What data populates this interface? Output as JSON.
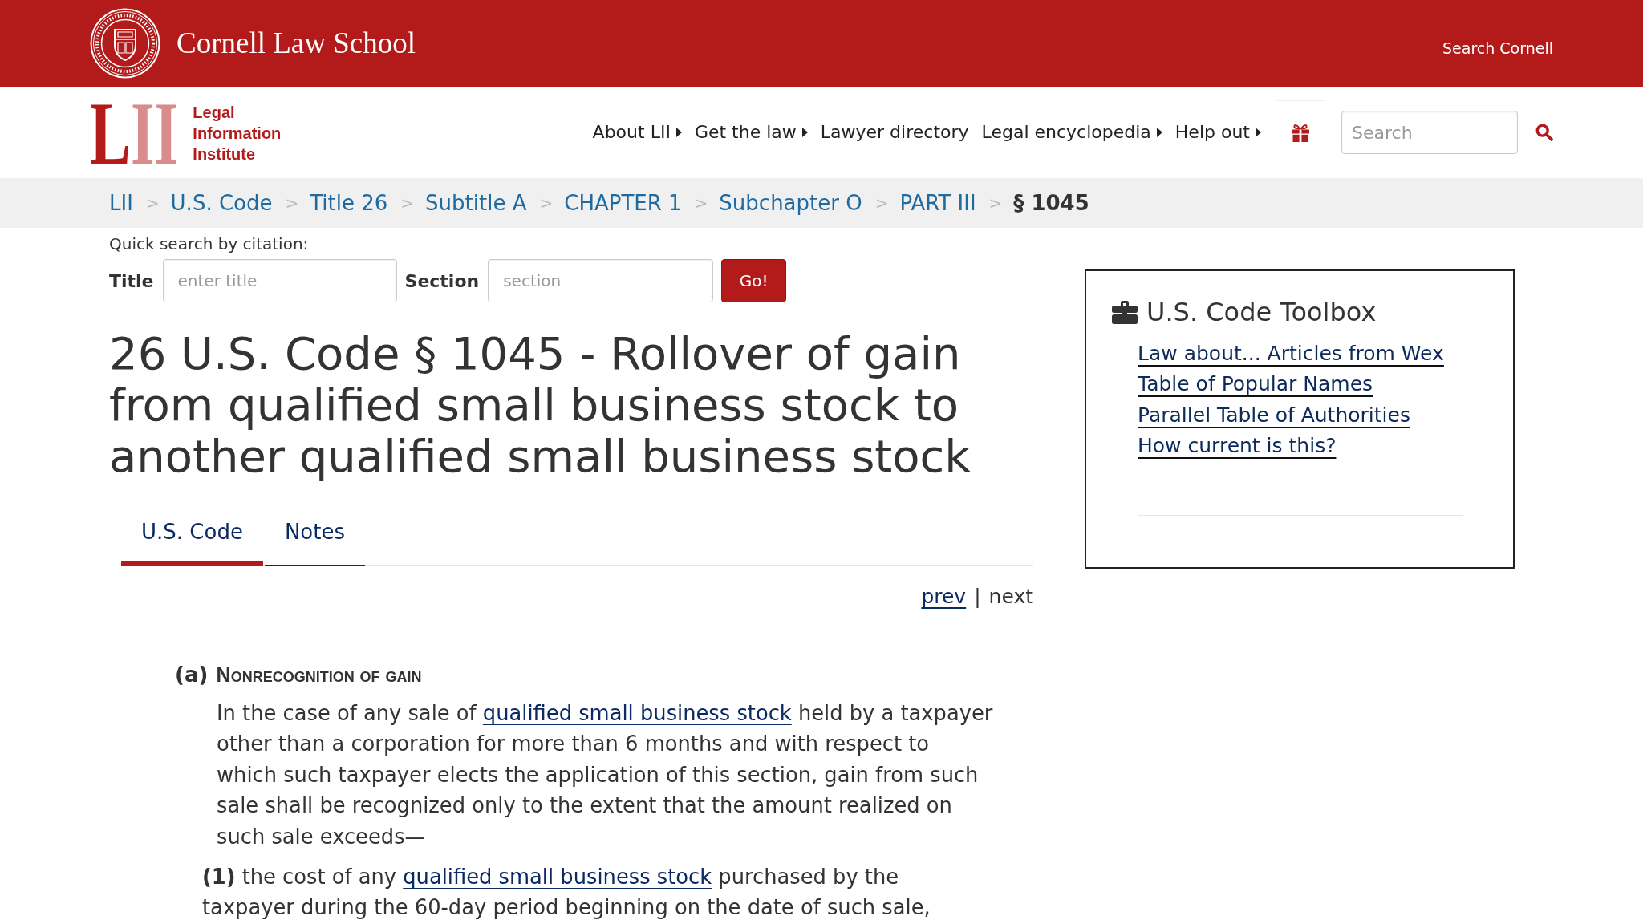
{
  "header": {
    "title": "Cornell Law School",
    "search_link": "Search Cornell"
  },
  "navbar": {
    "logo": {
      "mark": "LII",
      "text": "Legal Information Institute"
    },
    "menu": [
      {
        "label": "About LII",
        "has_submenu": true
      },
      {
        "label": "Get the law",
        "has_submenu": true
      },
      {
        "label": "Lawyer directory",
        "has_submenu": false
      },
      {
        "label": "Legal encyclopedia",
        "has_submenu": true
      },
      {
        "label": "Help out",
        "has_submenu": true
      }
    ],
    "search": {
      "placeholder": "Search"
    }
  },
  "breadcrumb": [
    {
      "label": "LII",
      "current": false
    },
    {
      "separator": ">",
      "label": "U.S. Code",
      "current": false
    },
    {
      "separator": ">",
      "label": "Title 26",
      "current": false
    },
    {
      "separator": ">",
      "label": "Subtitle A",
      "current": false
    },
    {
      "separator": ">",
      "label": "CHAPTER 1",
      "current": false
    },
    {
      "separator": ">",
      "label": "Subchapter O",
      "current": false
    },
    {
      "separator": ">",
      "label": "PART III",
      "current": false
    },
    {
      "separator": ">",
      "label": "§ 1045",
      "current": true
    }
  ],
  "quick_search": {
    "label": "Quick search by citation:",
    "fields": [
      {
        "label": "Title",
        "placeholder": "enter title"
      },
      {
        "label": "Section",
        "placeholder": "section"
      }
    ],
    "button": "Go!"
  },
  "heading": "26 U.S. Code § 1045 - Rollover of gain from qualified small business stock to another qualified small business stock",
  "tabs": [
    {
      "label": "U.S. Code",
      "selected": true
    },
    {
      "label": "Notes",
      "selected": false
    }
  ],
  "pager": {
    "prev": {
      "label": "prev",
      "disabled": false
    },
    "divider": "|",
    "next": {
      "label": "next",
      "disabled": true
    }
  },
  "section": {
    "label": "(a)",
    "title": "Nonrecognition of gain",
    "body": [
      {
        "kind": "text",
        "text": "In the case of any sale of "
      },
      {
        "kind": "link",
        "text": "qualified small business stock"
      },
      {
        "kind": "text",
        "text": " held by a taxpayer other than a corporation for more than 6 months and with respect to which such taxpayer elects the application of this section, gain from such sale shall be recognized only to the extent that the amount realized on such sale exceeds—"
      }
    ],
    "items": [
      {
        "label": "(1)",
        "body": [
          {
            "kind": "text",
            "text": "the cost of any "
          },
          {
            "kind": "link",
            "text": "qualified small business stock"
          },
          {
            "kind": "text",
            "text": " purchased by the taxpayer during the 60-day period beginning on the date of such sale,"
          }
        ]
      }
    ]
  },
  "toolbox": {
    "title": "U.S. Code Toolbox",
    "links": [
      "Law about... Articles from Wex",
      "Table of Popular Names",
      "Parallel Table of Authorities",
      "How current is this?"
    ]
  }
}
